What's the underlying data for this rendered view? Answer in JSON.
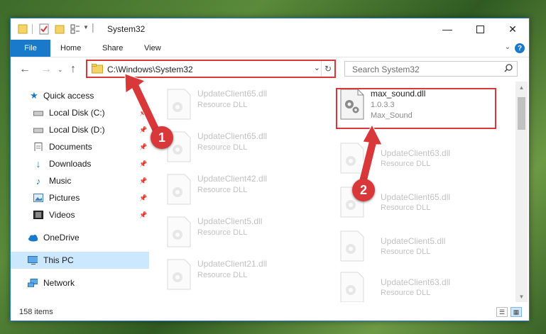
{
  "window": {
    "title": "System32"
  },
  "ribbon": {
    "tabs": [
      "File",
      "Home",
      "Share",
      "View"
    ],
    "help": "?"
  },
  "address": {
    "path": "C:\\Windows\\System32"
  },
  "search": {
    "placeholder": "Search System32"
  },
  "sidebar": {
    "items": [
      {
        "label": "Quick access",
        "icon": "star-icon",
        "pinned": false
      },
      {
        "label": "Local Disk (C:)",
        "icon": "drive-icon",
        "pinned": true
      },
      {
        "label": "Local Disk (D:)",
        "icon": "drive-icon",
        "pinned": true
      },
      {
        "label": "Documents",
        "icon": "document-icon",
        "pinned": true
      },
      {
        "label": "Downloads",
        "icon": "download-icon",
        "pinned": true
      },
      {
        "label": "Music",
        "icon": "music-icon",
        "pinned": true
      },
      {
        "label": "Pictures",
        "icon": "picture-icon",
        "pinned": true
      },
      {
        "label": "Videos",
        "icon": "video-icon",
        "pinned": true
      },
      {
        "label": "OneDrive",
        "icon": "cloud-icon",
        "pinned": false
      },
      {
        "label": "This PC",
        "icon": "computer-icon",
        "pinned": false,
        "selected": true
      },
      {
        "label": "Network",
        "icon": "network-icon",
        "pinned": false
      }
    ]
  },
  "files": {
    "left": [
      {
        "name": "UpdateClient65.dll",
        "type": "Resource DLL"
      },
      {
        "name": "UpdateClient65.dll",
        "type": "Resource DLL"
      },
      {
        "name": "UpdateClient42.dll",
        "type": "Resource DLL"
      },
      {
        "name": "UpdateClient5.dll",
        "type": "Resource DLL"
      },
      {
        "name": "UpdateClient21.dll",
        "type": "Resource DLL"
      }
    ],
    "right": [
      {
        "name": "max_sound.dll",
        "version": "1.0.3.3",
        "type": "Max_Sound",
        "highlighted": true
      },
      {
        "name": "UpdateClient63.dll",
        "type": "Resource DLL"
      },
      {
        "name": "UpdateClient65.dll",
        "type": "Resource DLL"
      },
      {
        "name": "UpdateClient5.dll",
        "type": "Resource DLL"
      },
      {
        "name": "UpdateClient63.dll",
        "type": "Resource DLL"
      }
    ]
  },
  "status": {
    "item_count": "158 items"
  },
  "annotations": {
    "badge1": "1",
    "badge2": "2",
    "color": "#d9383a"
  }
}
